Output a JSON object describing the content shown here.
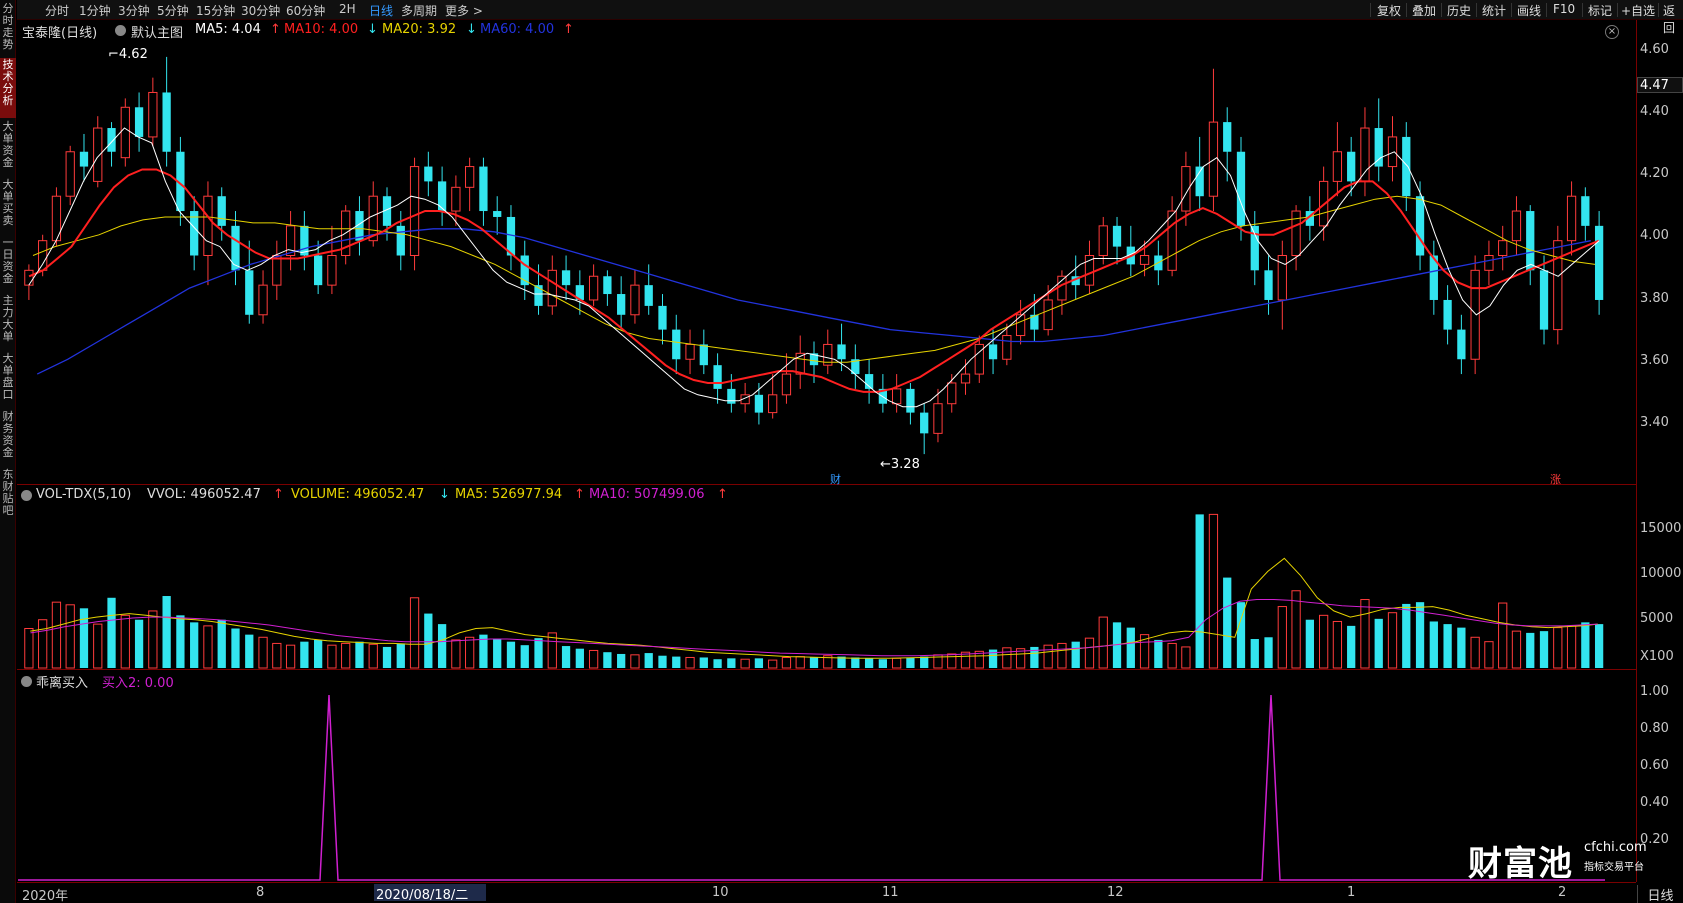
{
  "sidebar": {
    "tabs": [
      {
        "label": "分时走势",
        "active": false
      },
      {
        "label": "技术分析",
        "active": true
      },
      {
        "label": "大单资金",
        "active": false
      },
      {
        "label": "大单买卖",
        "active": false
      },
      {
        "label": "一日资金",
        "active": false
      },
      {
        "label": "主力大单",
        "active": false
      },
      {
        "label": "大单盘口",
        "active": false
      },
      {
        "label": "财务资金",
        "active": false
      },
      {
        "label": "东财贴吧",
        "active": false
      }
    ]
  },
  "periods": [
    "分时",
    "1分钟",
    "3分钟",
    "5分钟",
    "15分钟",
    "30分钟",
    "60分钟",
    "2H",
    "日线",
    "多周期",
    "更多 >"
  ],
  "active_period": "日线",
  "tools": [
    "复权",
    "叠加",
    "历史",
    "统计",
    "画线",
    "F10",
    "标记",
    "+自选",
    "返回"
  ],
  "price_header": {
    "stock": "宝泰隆(日线)",
    "template": "默认主图",
    "ma5": "MA5: 4.04",
    "ma10": "MA10: 4.00",
    "ma20": "MA20: 3.92",
    "ma60": "MA60: 4.00",
    "ma5_arrow": "↑",
    "ma10_arrow": "↓",
    "ma20_arrow": "↓",
    "ma60_arrow": "↑"
  },
  "vol_header": {
    "title": "VOL-TDX(5,10)",
    "vvol": "VVOL: 496052.47",
    "volume": "VOLUME: 496052.47",
    "ma5": "MA5: 526977.94",
    "ma10": "MA10: 507499.06",
    "up": "↑",
    "down": "↓"
  },
  "ind_header": {
    "title": "乖离买入",
    "value": "买入2: 0.00"
  },
  "price_axis": [
    "4.60",
    "4.40",
    "4.20",
    "4.00",
    "3.80",
    "3.60",
    "3.40"
  ],
  "price_tag": "4.47",
  "vol_axis": [
    "15000",
    "10000",
    "5000",
    "X100"
  ],
  "ind_axis": [
    "1.00",
    "0.80",
    "0.60",
    "0.40",
    "0.20"
  ],
  "date_axis": [
    "2020年",
    "8",
    "10",
    "11",
    "12",
    "1",
    "2"
  ],
  "date_highlight": "2020/08/18/二",
  "bottom_tab": "日线",
  "annotations": {
    "high": "4.62",
    "low": "3.28",
    "marker_cai": "财",
    "marker_zhang": "涨"
  },
  "logo": {
    "main": "财富池",
    "site": "cfchi.com",
    "slogan": "指标交易平台"
  },
  "colors": {
    "up": "#ff3b3b",
    "down": "#33e5ef",
    "ma5": "#ffffff",
    "ma10": "#ff2020",
    "ma20": "#e6d300",
    "ma60": "#2233dd",
    "signal": "#d020d0",
    "axis": "#7a0000"
  },
  "chart_data": {
    "type": "candlestick",
    "title": "宝泰隆(日线)",
    "y_range": [
      3.25,
      4.65
    ],
    "candles": [
      [
        3.85,
        3.9,
        3.8,
        3.92
      ],
      [
        3.9,
        4.0,
        3.88,
        4.02
      ],
      [
        4.0,
        4.15,
        3.98,
        4.18
      ],
      [
        4.15,
        4.3,
        4.12,
        4.32
      ],
      [
        4.3,
        4.25,
        4.2,
        4.36
      ],
      [
        4.2,
        4.38,
        4.18,
        4.42
      ],
      [
        4.38,
        4.3,
        4.25,
        4.4
      ],
      [
        4.28,
        4.45,
        4.25,
        4.48
      ],
      [
        4.45,
        4.35,
        4.3,
        4.5
      ],
      [
        4.35,
        4.5,
        4.32,
        4.55
      ],
      [
        4.5,
        4.3,
        4.25,
        4.62
      ],
      [
        4.3,
        4.1,
        4.05,
        4.35
      ],
      [
        4.1,
        3.95,
        3.9,
        4.15
      ],
      [
        3.95,
        4.15,
        3.85,
        4.2
      ],
      [
        4.15,
        4.05,
        4.0,
        4.18
      ],
      [
        4.05,
        3.9,
        3.85,
        4.1
      ],
      [
        3.9,
        3.75,
        3.72,
        4.0
      ],
      [
        3.75,
        3.85,
        3.72,
        3.9
      ],
      [
        3.85,
        3.95,
        3.8,
        4.0
      ],
      [
        3.95,
        4.05,
        3.9,
        4.1
      ],
      [
        4.05,
        3.95,
        3.9,
        4.1
      ],
      [
        3.95,
        3.85,
        3.82,
        4.0
      ],
      [
        3.85,
        3.95,
        3.82,
        4.05
      ],
      [
        3.95,
        4.1,
        3.92,
        4.12
      ],
      [
        4.1,
        4.0,
        3.95,
        4.15
      ],
      [
        4.0,
        4.15,
        3.98,
        4.2
      ],
      [
        4.15,
        4.05,
        4.0,
        4.18
      ],
      [
        4.05,
        3.95,
        3.9,
        4.1
      ],
      [
        3.95,
        4.25,
        3.9,
        4.28
      ],
      [
        4.25,
        4.2,
        4.15,
        4.3
      ],
      [
        4.2,
        4.1,
        4.05,
        4.25
      ],
      [
        4.1,
        4.18,
        4.05,
        4.22
      ],
      [
        4.18,
        4.25,
        4.1,
        4.28
      ],
      [
        4.25,
        4.1,
        4.05,
        4.28
      ],
      [
        4.1,
        4.08,
        4.02,
        4.15
      ],
      [
        4.08,
        3.95,
        3.9,
        4.12
      ],
      [
        3.95,
        3.85,
        3.8,
        4.0
      ],
      [
        3.85,
        3.78,
        3.75,
        3.92
      ],
      [
        3.78,
        3.9,
        3.75,
        3.95
      ],
      [
        3.9,
        3.85,
        3.8,
        3.95
      ],
      [
        3.85,
        3.8,
        3.75,
        3.9
      ],
      [
        3.8,
        3.88,
        3.78,
        3.92
      ],
      [
        3.88,
        3.82,
        3.78,
        3.9
      ],
      [
        3.82,
        3.75,
        3.7,
        3.88
      ],
      [
        3.75,
        3.85,
        3.72,
        3.9
      ],
      [
        3.85,
        3.78,
        3.75,
        3.92
      ],
      [
        3.78,
        3.7,
        3.65,
        3.82
      ],
      [
        3.7,
        3.6,
        3.55,
        3.75
      ],
      [
        3.6,
        3.65,
        3.55,
        3.7
      ],
      [
        3.65,
        3.58,
        3.55,
        3.7
      ],
      [
        3.58,
        3.5,
        3.45,
        3.62
      ],
      [
        3.5,
        3.45,
        3.42,
        3.55
      ],
      [
        3.45,
        3.48,
        3.42,
        3.52
      ],
      [
        3.48,
        3.42,
        3.38,
        3.52
      ],
      [
        3.42,
        3.48,
        3.4,
        3.55
      ],
      [
        3.48,
        3.55,
        3.45,
        3.62
      ],
      [
        3.55,
        3.62,
        3.5,
        3.68
      ],
      [
        3.62,
        3.58,
        3.52,
        3.66
      ],
      [
        3.58,
        3.65,
        3.55,
        3.7
      ],
      [
        3.65,
        3.6,
        3.56,
        3.72
      ],
      [
        3.6,
        3.55,
        3.5,
        3.65
      ],
      [
        3.55,
        3.5,
        3.45,
        3.6
      ],
      [
        3.5,
        3.45,
        3.42,
        3.55
      ],
      [
        3.45,
        3.5,
        3.42,
        3.55
      ],
      [
        3.5,
        3.42,
        3.38,
        3.52
      ],
      [
        3.42,
        3.35,
        3.28,
        3.45
      ],
      [
        3.35,
        3.45,
        3.32,
        3.5
      ],
      [
        3.45,
        3.52,
        3.42,
        3.55
      ],
      [
        3.52,
        3.55,
        3.48,
        3.6
      ],
      [
        3.55,
        3.65,
        3.52,
        3.68
      ],
      [
        3.65,
        3.6,
        3.55,
        3.7
      ],
      [
        3.6,
        3.68,
        3.58,
        3.72
      ],
      [
        3.68,
        3.75,
        3.65,
        3.8
      ],
      [
        3.75,
        3.7,
        3.66,
        3.82
      ],
      [
        3.7,
        3.8,
        3.68,
        3.85
      ],
      [
        3.8,
        3.88,
        3.75,
        3.9
      ],
      [
        3.88,
        3.85,
        3.8,
        3.95
      ],
      [
        3.85,
        3.95,
        3.82,
        4.0
      ],
      [
        3.95,
        4.05,
        3.92,
        4.08
      ],
      [
        4.05,
        3.98,
        3.92,
        4.08
      ],
      [
        3.98,
        3.92,
        3.88,
        4.05
      ],
      [
        3.92,
        3.95,
        3.88,
        4.0
      ],
      [
        3.95,
        3.9,
        3.85,
        4.0
      ],
      [
        3.9,
        4.1,
        3.88,
        4.15
      ],
      [
        4.1,
        4.25,
        4.05,
        4.3
      ],
      [
        4.25,
        4.15,
        4.1,
        4.35
      ],
      [
        4.15,
        4.4,
        4.1,
        4.58
      ],
      [
        4.4,
        4.3,
        4.2,
        4.45
      ],
      [
        4.3,
        4.05,
        4.0,
        4.35
      ],
      [
        4.05,
        3.9,
        3.85,
        4.1
      ],
      [
        3.9,
        3.8,
        3.75,
        3.95
      ],
      [
        3.8,
        3.95,
        3.7,
        4.0
      ],
      [
        3.95,
        4.1,
        3.9,
        4.12
      ],
      [
        4.1,
        4.05,
        4.0,
        4.15
      ],
      [
        4.05,
        4.2,
        4.0,
        4.25
      ],
      [
        4.2,
        4.3,
        4.15,
        4.4
      ],
      [
        4.3,
        4.2,
        4.15,
        4.35
      ],
      [
        4.2,
        4.38,
        4.15,
        4.45
      ],
      [
        4.38,
        4.25,
        4.2,
        4.48
      ],
      [
        4.25,
        4.35,
        4.2,
        4.42
      ],
      [
        4.35,
        4.15,
        4.1,
        4.4
      ],
      [
        4.15,
        3.95,
        3.9,
        4.2
      ],
      [
        3.95,
        3.8,
        3.75,
        4.0
      ],
      [
        3.8,
        3.7,
        3.65,
        3.85
      ],
      [
        3.7,
        3.6,
        3.55,
        3.75
      ],
      [
        3.6,
        3.9,
        3.55,
        3.95
      ],
      [
        3.9,
        3.95,
        3.85,
        4.0
      ],
      [
        3.95,
        4.0,
        3.9,
        4.05
      ],
      [
        4.0,
        4.1,
        3.95,
        4.15
      ],
      [
        4.1,
        3.9,
        3.85,
        4.12
      ],
      [
        3.9,
        3.7,
        3.65,
        3.95
      ],
      [
        3.7,
        4.0,
        3.65,
        4.05
      ],
      [
        4.0,
        4.15,
        3.95,
        4.2
      ],
      [
        4.15,
        4.05,
        4.0,
        4.18
      ],
      [
        4.05,
        3.8,
        3.75,
        4.1
      ]
    ],
    "ma5": [
      3.85,
      3.92,
      4.0,
      4.1,
      4.2,
      4.28,
      4.33,
      4.38,
      4.35,
      4.33,
      4.2,
      4.1,
      4.05,
      4.0,
      3.98,
      3.92,
      3.9,
      3.92,
      3.95,
      3.97,
      3.96,
      3.97,
      4.0,
      4.02,
      4.05,
      4.08,
      4.1,
      4.12,
      4.15,
      4.14,
      4.12,
      4.08,
      4.02,
      3.96,
      3.9,
      3.86,
      3.84,
      3.82,
      3.82,
      3.81,
      3.8,
      3.78,
      3.74,
      3.7,
      3.66,
      3.62,
      3.58,
      3.54,
      3.5,
      3.48,
      3.47,
      3.46,
      3.46,
      3.48,
      3.52,
      3.56,
      3.6,
      3.62,
      3.61,
      3.6,
      3.57,
      3.53,
      3.49,
      3.46,
      3.44,
      3.44,
      3.46,
      3.5,
      3.55,
      3.6,
      3.64,
      3.68,
      3.72,
      3.76,
      3.8,
      3.84,
      3.88,
      3.92,
      3.94,
      3.94,
      3.94,
      3.96,
      4.0,
      4.05,
      4.1,
      4.18,
      4.25,
      4.28,
      4.22,
      4.1,
      4.0,
      3.94,
      3.92,
      3.95,
      4.0,
      4.05,
      4.12,
      4.18,
      4.24,
      4.28,
      4.3,
      4.25,
      4.15,
      4.02,
      3.9,
      3.8,
      3.75,
      3.78,
      3.85,
      3.9,
      3.92,
      3.9,
      3.88,
      3.92,
      3.96,
      4.0
    ],
    "ma10": [
      3.88,
      3.9,
      3.94,
      3.98,
      4.05,
      4.12,
      4.18,
      4.22,
      4.24,
      4.24,
      4.22,
      4.18,
      4.12,
      4.06,
      4.02,
      3.99,
      3.96,
      3.94,
      3.94,
      3.94,
      3.95,
      3.96,
      3.97,
      3.99,
      4.01,
      4.03,
      4.06,
      4.08,
      4.1,
      4.1,
      4.09,
      4.07,
      4.04,
      4.0,
      3.96,
      3.92,
      3.89,
      3.86,
      3.83,
      3.8,
      3.77,
      3.74,
      3.7,
      3.66,
      3.62,
      3.58,
      3.55,
      3.53,
      3.52,
      3.52,
      3.53,
      3.54,
      3.55,
      3.56,
      3.56,
      3.55,
      3.54,
      3.52,
      3.5,
      3.49,
      3.49,
      3.5,
      3.52,
      3.54,
      3.57,
      3.6,
      3.63,
      3.66,
      3.7,
      3.73,
      3.76,
      3.79,
      3.82,
      3.85,
      3.87,
      3.89,
      3.91,
      3.93,
      3.95,
      3.98,
      4.02,
      4.06,
      4.09,
      4.11,
      4.09,
      4.06,
      4.03,
      4.02,
      4.02,
      4.04,
      4.06,
      4.1,
      4.14,
      4.18,
      4.2,
      4.2,
      4.16,
      4.1,
      4.03,
      3.96,
      3.9,
      3.86,
      3.84,
      3.84,
      3.86,
      3.88,
      3.9,
      3.92,
      3.94,
      3.96,
      3.98,
      4.0
    ],
    "ma20": [
      3.95,
      3.98,
      4.0,
      4.02,
      4.05,
      4.07,
      4.08,
      4.08,
      4.08,
      4.07,
      4.06,
      4.06,
      4.05,
      4.04,
      4.04,
      4.04,
      4.03,
      4.02,
      4.0,
      3.98,
      3.95,
      3.92,
      3.88,
      3.84,
      3.8,
      3.76,
      3.72,
      3.69,
      3.67,
      3.66,
      3.65,
      3.64,
      3.63,
      3.62,
      3.61,
      3.6,
      3.59,
      3.59,
      3.6,
      3.61,
      3.62,
      3.63,
      3.65,
      3.67,
      3.7,
      3.73,
      3.76,
      3.79,
      3.82,
      3.85,
      3.88,
      3.92,
      3.96,
      4.0,
      4.03,
      4.05,
      4.06,
      4.07,
      4.08,
      4.1,
      4.12,
      4.14,
      4.15,
      4.14,
      4.12,
      4.08,
      4.04,
      4.0,
      3.97,
      3.95,
      3.93,
      3.92
    ],
    "ma60": [
      3.55,
      3.6,
      3.66,
      3.72,
      3.78,
      3.84,
      3.88,
      3.92,
      3.95,
      3.98,
      4.0,
      4.02,
      4.03,
      4.04,
      4.04,
      4.03,
      4.01,
      3.98,
      3.95,
      3.92,
      3.89,
      3.86,
      3.83,
      3.8,
      3.78,
      3.76,
      3.74,
      3.72,
      3.7,
      3.69,
      3.68,
      3.67,
      3.66,
      3.66,
      3.67,
      3.68,
      3.7,
      3.72,
      3.74,
      3.76,
      3.78,
      3.8,
      3.82,
      3.84,
      3.86,
      3.88,
      3.9,
      3.92,
      3.94,
      3.96,
      3.98,
      4.0
    ],
    "volume": [
      4500,
      5500,
      7500,
      7200,
      6800,
      5000,
      8000,
      6000,
      5500,
      6500,
      8200,
      6000,
      5200,
      4800,
      5500,
      4500,
      3800,
      3500,
      2800,
      2600,
      3000,
      3200,
      2600,
      2800,
      3000,
      2700,
      2400,
      2800,
      8000,
      6200,
      5000,
      3200,
      3500,
      3800,
      3300,
      3000,
      2600,
      3400,
      4000,
      2500,
      2200,
      2000,
      1800,
      1600,
      1500,
      1700,
      1400,
      1300,
      1200,
      1200,
      1000,
      1100,
      1000,
      1100,
      900,
      1200,
      1300,
      1200,
      1400,
      1300,
      1200,
      1100,
      1000,
      1100,
      1200,
      1300,
      1500,
      1600,
      1800,
      1900,
      2100,
      2300,
      2200,
      2400,
      2600,
      2800,
      3000,
      3400,
      5800,
      5200,
      4600,
      3800,
      3200,
      2800,
      2400,
      17500,
      17500,
      10300,
      7500,
      3300,
      3500,
      7000,
      8800,
      5500,
      6000,
      5300,
      4800,
      7800,
      5600,
      6300,
      7300,
      7500,
      5300,
      5000,
      4600,
      3500,
      3000,
      7400,
      4200,
      4000,
      4200,
      4600,
      4800,
      5200,
      5000
    ],
    "vol_ma5": [
      4200,
      4500,
      5000,
      5500,
      5800,
      6000,
      6200,
      6000,
      5800,
      5600,
      5500,
      5300,
      5000,
      4700,
      4400,
      4000,
      3600,
      3300,
      3100,
      3000,
      2900,
      2800,
      2800,
      2700,
      2700,
      3200,
      4000,
      4500,
      4600,
      4200,
      3800,
      3600,
      3400,
      3200,
      3000,
      2800,
      2700,
      2600,
      2400,
      2200,
      2000,
      1800,
      1700,
      1600,
      1500,
      1400,
      1300,
      1250,
      1200,
      1150,
      1100,
      1100,
      1100,
      1150,
      1200,
      1250,
      1300,
      1350,
      1400,
      1500,
      1600,
      1700,
      1900,
      2100,
      2300,
      2500,
      2700,
      3000,
      3500,
      4000,
      4200,
      4100,
      3800,
      3500,
      9000,
      11000,
      12500,
      10500,
      8000,
      6500,
      5800,
      6200,
      6700,
      6900,
      6900,
      7000,
      6600,
      6000,
      5600,
      5200,
      4900,
      4700,
      4600,
      4700,
      4800,
      5000
    ],
    "vol_ma10": [
      4000,
      4300,
      4700,
      5000,
      5300,
      5500,
      5700,
      5800,
      5800,
      5700,
      5600,
      5500,
      5300,
      5100,
      4900,
      4600,
      4300,
      4000,
      3700,
      3500,
      3300,
      3100,
      3000,
      3000,
      3000,
      3100,
      3200,
      3300,
      3300,
      3200,
      3100,
      3000,
      2900,
      2800,
      2700,
      2600,
      2500,
      2400,
      2300,
      2200,
      2100,
      2000,
      1900,
      1800,
      1700,
      1650,
      1600,
      1550,
      1500,
      1450,
      1400,
      1400,
      1400,
      1450,
      1500,
      1600,
      1700,
      1800,
      1900,
      2000,
      2100,
      2200,
      2300,
      2500,
      2700,
      2900,
      3000,
      3100,
      3500,
      5500,
      6800,
      7600,
      7800,
      7800,
      7700,
      7500,
      7300,
      7100,
      7000,
      6900,
      6800,
      6600,
      6300,
      6000,
      5700,
      5400,
      5100,
      4900,
      4800,
      4800,
      4800,
      4900,
      5000
    ]
  }
}
